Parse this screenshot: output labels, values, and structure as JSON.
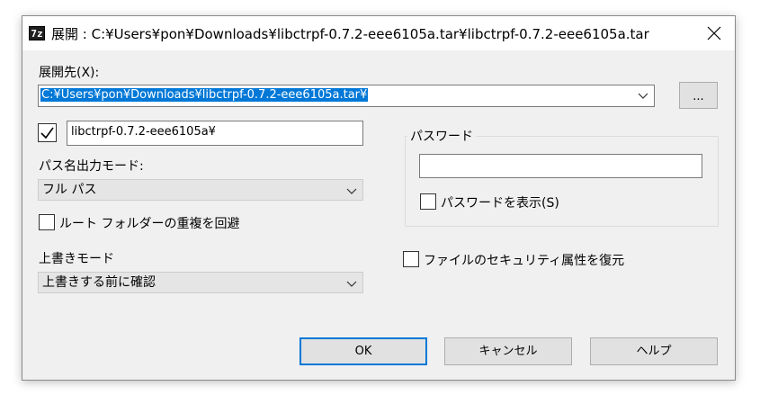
{
  "window": {
    "title": "展開 : C:¥Users¥pon¥Downloads¥libctrpf-0.7.2-eee6105a.tar¥libctrpf-0.7.2-eee6105a.tar",
    "app_icon_text": "7z"
  },
  "extract_to": {
    "label": "展開先(X):",
    "value": "C:¥Users¥pon¥Downloads¥libctrpf-0.7.2-eee6105a.tar¥",
    "browse_label": "..."
  },
  "subfolder": {
    "checked": true,
    "value": "libctrpf-0.7.2-eee6105a¥"
  },
  "path_mode": {
    "label": "パス名出力モード:",
    "selected": "フル パス"
  },
  "eliminate_dup": {
    "label": "ルート フォルダーの重複を回避",
    "checked": false
  },
  "overwrite": {
    "label": "上書きモード",
    "selected": "上書きする前に確認"
  },
  "password": {
    "group_label": "パスワード",
    "value": "",
    "show_label": "パスワードを表示(S)",
    "show_checked": false
  },
  "restore_security": {
    "label": "ファイルのセキュリティ属性を復元",
    "checked": false
  },
  "buttons": {
    "ok": "OK",
    "cancel": "キャンセル",
    "help": "ヘルプ"
  },
  "colors": {
    "selection": "#0078d7",
    "dialog_bg": "#f0f0f0"
  }
}
